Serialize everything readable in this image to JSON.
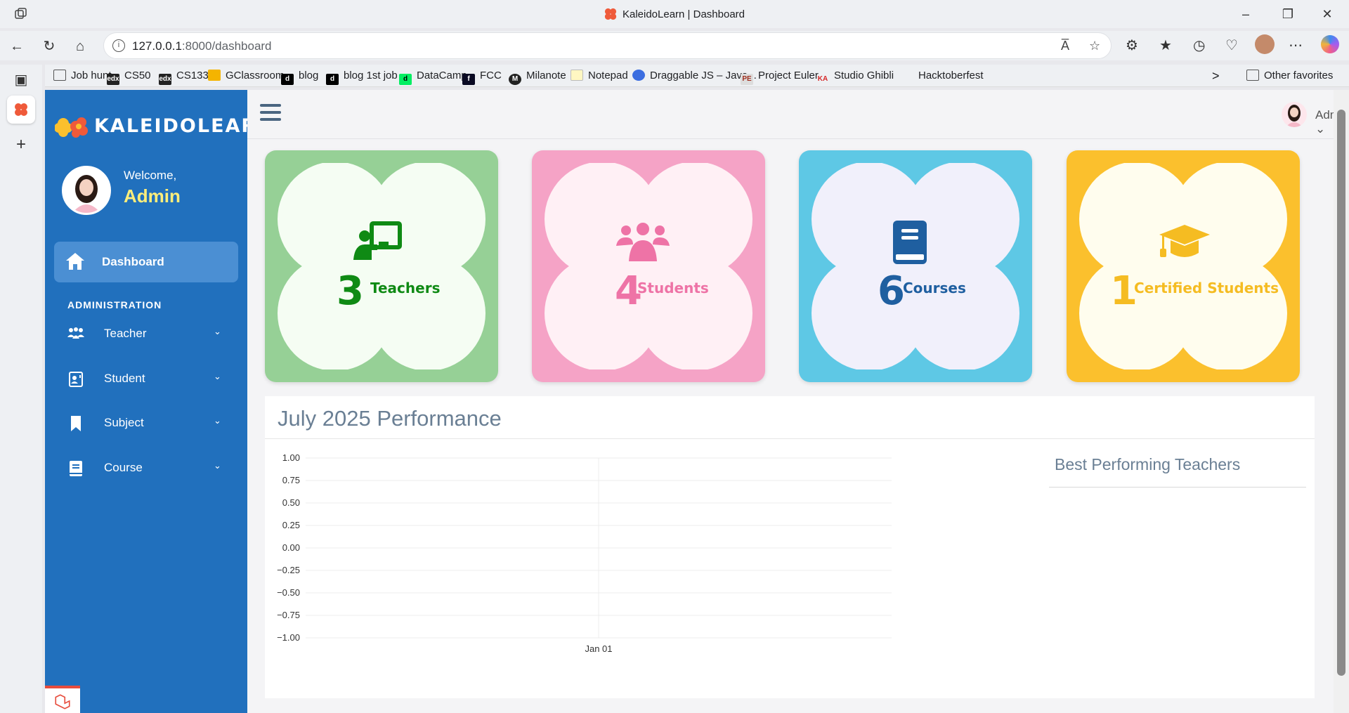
{
  "browser": {
    "window_title": "KaleidoLearn | Dashboard",
    "url_host": "127.0.0.1",
    "url_rest": ":8000/dashboard",
    "read_aloud_label": "A̅",
    "bookmarks": [
      {
        "label": "Job hunt",
        "icon": "folder-icon"
      },
      {
        "label": "CS50",
        "icon": "edx-icon"
      },
      {
        "label": "CS1331",
        "icon": "edx-icon"
      },
      {
        "label": "GClassroom",
        "icon": "classroom-icon"
      },
      {
        "label": "blog",
        "icon": "dev-icon"
      },
      {
        "label": "blog 1st job",
        "icon": "dev-icon"
      },
      {
        "label": "DataCamp",
        "icon": "datacamp-icon"
      },
      {
        "label": "FCC",
        "icon": "fcc-icon"
      },
      {
        "label": "Milanote",
        "icon": "milanote-icon"
      },
      {
        "label": "Notepad",
        "icon": "notepad-icon"
      },
      {
        "label": "Draggable JS – Java...",
        "icon": "drop-icon"
      },
      {
        "label": "Project Euler",
        "icon": "pe-icon"
      },
      {
        "label": "Studio Ghibli",
        "icon": "ka-icon"
      },
      {
        "label": "Hacktoberfest",
        "icon": "blank-icon"
      }
    ],
    "other_favorites": "Other favorites",
    "more_bookmarks": ">"
  },
  "sidebar": {
    "logo_text": "KALEIDOLEARN",
    "welcome": "Welcome,",
    "user_name": "Admin",
    "dashboard_label": "Dashboard",
    "section_label": "ADMINISTRATION",
    "items": [
      {
        "label": "Teacher",
        "icon": "teacher-icon"
      },
      {
        "label": "Student",
        "icon": "student-icon"
      },
      {
        "label": "Subject",
        "icon": "bookmark-icon"
      },
      {
        "label": "Course",
        "icon": "book-icon"
      }
    ]
  },
  "topbar": {
    "user_label": "Admin"
  },
  "cards": [
    {
      "count": "3",
      "label": "Teachers",
      "bg": "#96d096",
      "fg": "#0f8a14",
      "inner": "#f5fdf3"
    },
    {
      "count": "4",
      "label": "Students",
      "bg": "#f5a3c6",
      "fg": "#ee73a6",
      "inner": "#fff0f5"
    },
    {
      "count": "6",
      "label": "Courses",
      "bg": "#5ec8e5",
      "fg": "#1f5fa0",
      "inner": "#f1f0fb"
    },
    {
      "count": "1",
      "label": "Certified Students",
      "bg": "#fbc02d",
      "fg": "#f5bc22",
      "inner": "#fffdee"
    }
  ],
  "performance": {
    "title": "July 2025 Performance",
    "best_title": "Best Performing Teachers"
  },
  "chart_data": {
    "type": "line",
    "x": [
      "Jan 01"
    ],
    "series": [],
    "yticks": [
      "1.00",
      "0.75",
      "0.50",
      "0.25",
      "0.00",
      "−0.25",
      "−0.50",
      "−0.75",
      "−1.00"
    ],
    "ylim": [
      -1,
      1
    ],
    "grid": true
  }
}
